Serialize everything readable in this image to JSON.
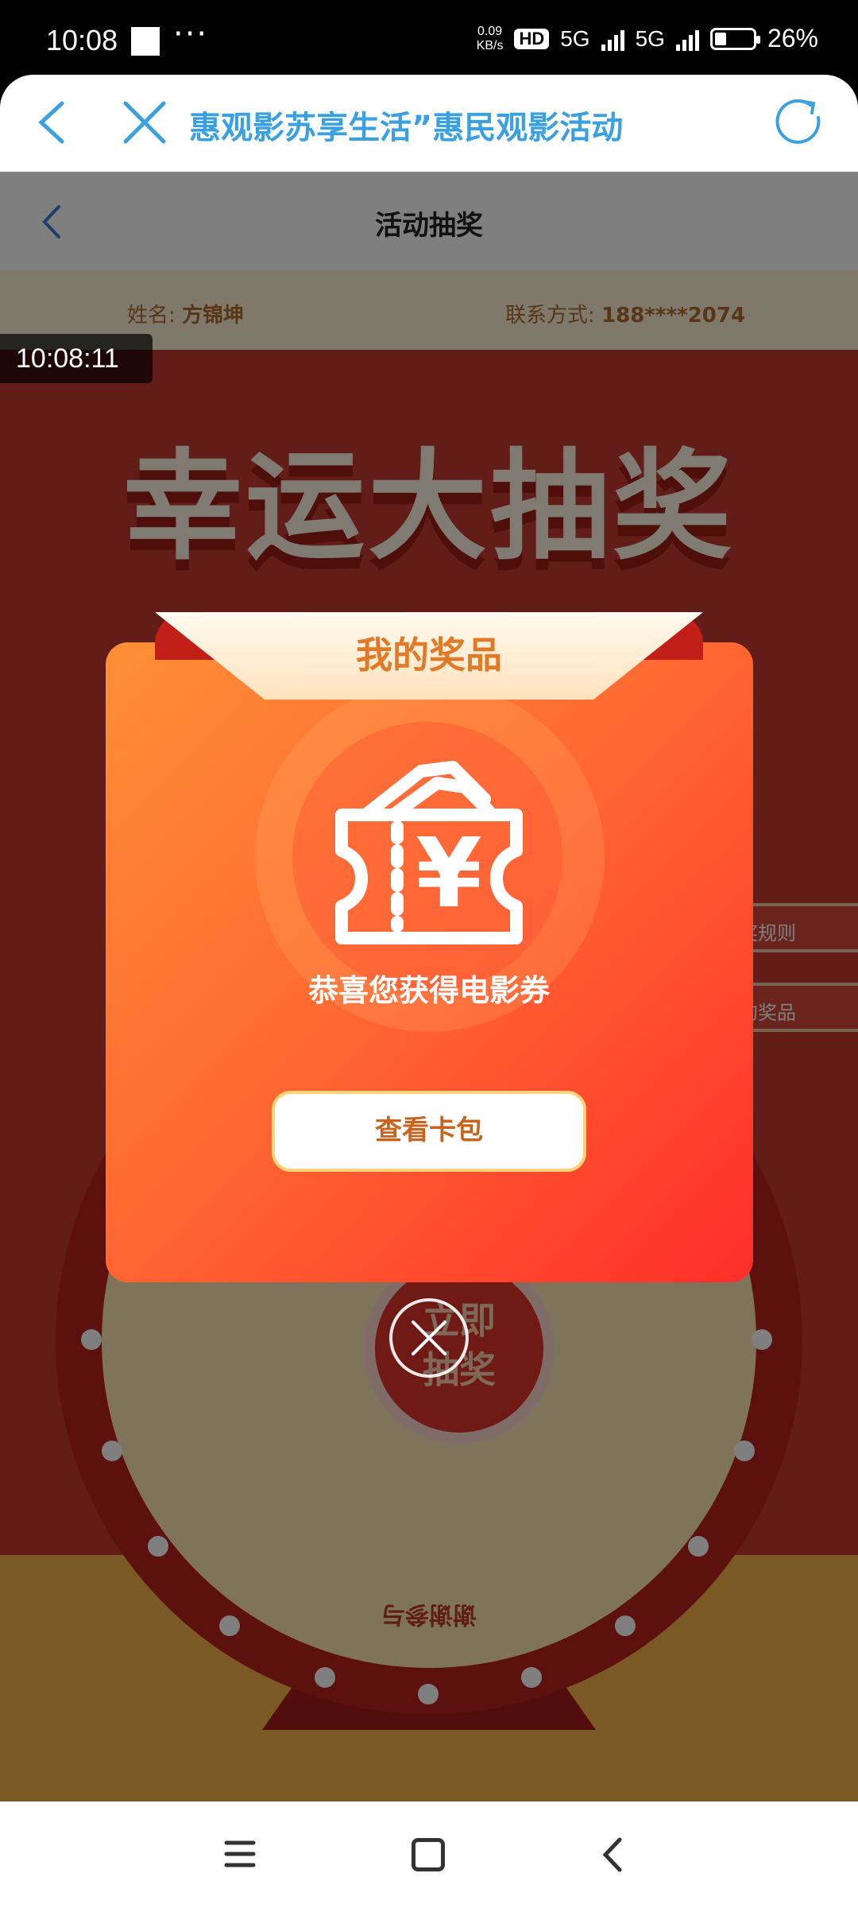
{
  "status_bar": {
    "time": "10:08",
    "more": "···",
    "net_speed": "0.09",
    "net_unit": "KB/s",
    "hd_badge": "HD",
    "signal_1": "5G",
    "signal_2": "5G",
    "battery": "26%"
  },
  "browser": {
    "title": "惠观影苏享生活”惠民观影活动"
  },
  "page": {
    "header_title": "活动抽奖",
    "name_label": "姓名:",
    "name_value": "方锦坤",
    "contact_label": "联系方式:",
    "contact_value": "188****2074",
    "banner_title": "幸运大抽奖",
    "side_tabs": [
      "奖规则",
      "的奖品"
    ],
    "wheel_center": [
      "立即",
      "抽奖"
    ],
    "wheel_label": "谢谢参与"
  },
  "timestamp": "10:08:11",
  "modal": {
    "ribbon_title": "我的奖品",
    "message": "恭喜您获得电影券",
    "button_label": "查看卡包",
    "coupon_symbol": "¥"
  },
  "colors": {
    "accent_blue": "#3aa0e0",
    "modal_orange": "#ff6a32",
    "modal_red": "#ff2e2a",
    "button_text": "#c8641e"
  }
}
